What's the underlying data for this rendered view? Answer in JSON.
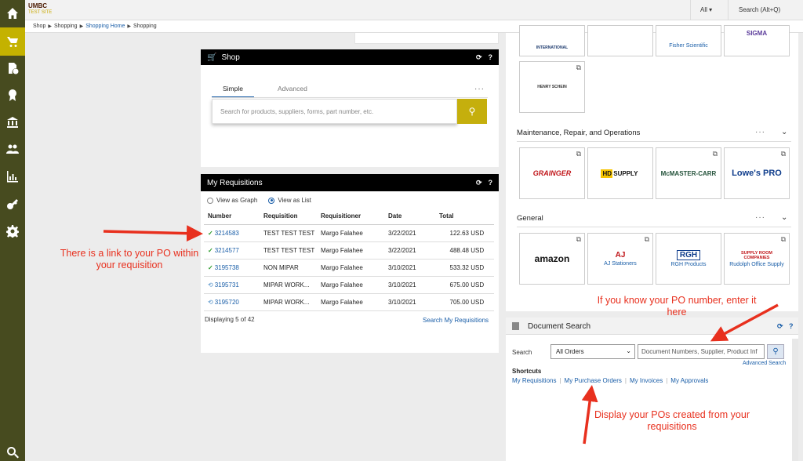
{
  "header": {
    "logo_line1": "UMBC",
    "logo_line2": "TEST SITE",
    "scope_select": "All",
    "search_label": "Search (Alt+Q)"
  },
  "breadcrumb": [
    "Shop",
    "Shopping",
    "Shopping Home",
    "Shopping"
  ],
  "sidebar": {
    "items": [
      "home-icon",
      "shopping-cart-icon",
      "clock-document-icon",
      "ribbon-icon",
      "bank-icon",
      "users-icon",
      "bar-chart-icon",
      "key-icon",
      "gear-icon",
      "search-icon"
    ],
    "active_color": "#c4b200",
    "background": "#474b1f"
  },
  "shop": {
    "title": "Shop",
    "tab_simple": "Simple",
    "tab_advanced": "Advanced",
    "search_placeholder": "Search for products, suppliers, forms, part number, etc."
  },
  "requisitions": {
    "title": "My Requisitions",
    "view_graph": "View as Graph",
    "view_list": "View as List",
    "columns": [
      "Number",
      "Requisition",
      "Requisitioner",
      "Date",
      "Total"
    ],
    "rows": [
      {
        "status": "check",
        "number": "3214583",
        "requisition": "TEST TEST TEST",
        "requisitioner": "Margo Falahee",
        "date": "3/22/2021",
        "total": "122.63",
        "currency": "USD"
      },
      {
        "status": "check",
        "number": "3214577",
        "requisition": "TEST TEST TEST",
        "requisitioner": "Margo Falahee",
        "date": "3/22/2021",
        "total": "488.48",
        "currency": "USD"
      },
      {
        "status": "check",
        "number": "3195738",
        "requisition": "NON MIPAR",
        "requisitioner": "Margo Falahee",
        "date": "3/10/2021",
        "total": "533.32",
        "currency": "USD"
      },
      {
        "status": "sync",
        "number": "3195731",
        "requisition": "MIPAR WORK...",
        "requisitioner": "Margo Falahee",
        "date": "3/10/2021",
        "total": "675.00",
        "currency": "USD"
      },
      {
        "status": "sync",
        "number": "3195720",
        "requisition": "MIPAR WORK...",
        "requisitioner": "Margo Falahee",
        "date": "3/10/2021",
        "total": "705.00",
        "currency": "USD"
      }
    ],
    "displaying": "Displaying 5 of 42",
    "search_link": "Search My Requisitions"
  },
  "suppliers": {
    "top_tiles": [
      {
        "logo": "INTERNATIONAL",
        "caption": ""
      },
      {
        "logo": "",
        "caption": ""
      },
      {
        "logo": "",
        "caption": "Fisher Scientific"
      },
      {
        "logo": "SIGMA",
        "caption": ""
      },
      {
        "logo": "HENRY SCHEIN",
        "caption": ""
      }
    ],
    "mro_title": "Maintenance, Repair, and Operations",
    "mro_tiles": [
      {
        "logo": "GRAINGER",
        "caption": ""
      },
      {
        "logo": "HD SUPPLY",
        "caption": ""
      },
      {
        "logo": "McMASTER-CARR",
        "caption": ""
      },
      {
        "logo": "Lowe's PRO",
        "caption": ""
      }
    ],
    "general_title": "General",
    "general_tiles": [
      {
        "logo": "amazon",
        "caption": ""
      },
      {
        "logo": "AJ",
        "caption": "AJ Stationers"
      },
      {
        "logo": "RGH",
        "caption": "RGH Products"
      },
      {
        "logo": "SUPPLY ROOM COMPANIES",
        "caption": "Rudolph Office Supply"
      }
    ]
  },
  "document_search": {
    "title": "Document Search",
    "search_label": "Search",
    "scope": "All Orders",
    "placeholder": "Document Numbers, Supplier, Product Inf",
    "advanced": "Advanced Search",
    "shortcuts_label": "Shortcuts",
    "shortcuts": [
      "My Requisitions",
      "My Purchase Orders",
      "My Invoices",
      "My Approvals"
    ]
  },
  "annotations": {
    "po_link": "There is a link to your PO within your requisition",
    "po_number": "If you know your PO number, enter it here",
    "display_pos": "Display your POs created from your requisitions",
    "color": "#e8301e"
  }
}
